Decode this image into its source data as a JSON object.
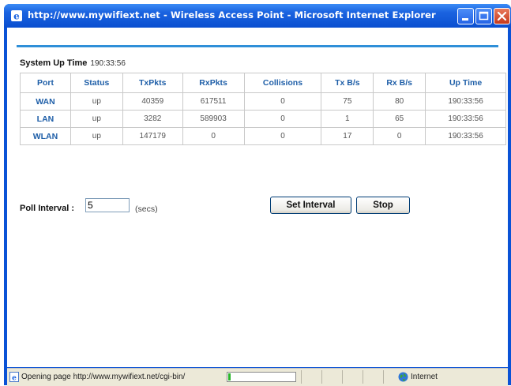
{
  "window": {
    "title": "http://www.mywifiext.net - Wireless Access Point - Microsoft Internet Explorer"
  },
  "uptime": {
    "label": "System Up Time",
    "value": "190:33:56"
  },
  "table": {
    "headers": [
      "Port",
      "Status",
      "TxPkts",
      "RxPkts",
      "Collisions",
      "Tx B/s",
      "Rx B/s",
      "Up Time"
    ],
    "rows": [
      [
        "WAN",
        "up",
        "40359",
        "617511",
        "0",
        "75",
        "80",
        "190:33:56"
      ],
      [
        "LAN",
        "up",
        "3282",
        "589903",
        "0",
        "1",
        "65",
        "190:33:56"
      ],
      [
        "WLAN",
        "up",
        "147179",
        "0",
        "0",
        "17",
        "0",
        "190:33:56"
      ]
    ]
  },
  "poll": {
    "label": "Poll Interval :",
    "value": "5",
    "unit": "(secs)"
  },
  "buttons": {
    "set_interval": "Set Interval",
    "stop": "Stop"
  },
  "statusbar": {
    "text": "Opening page http://www.mywifiext.net/cgi-bin/",
    "progress": 0.03,
    "zone": "Internet"
  },
  "icons": {
    "browser": "ie-icon",
    "minimize": "minimize-icon",
    "maximize": "maximize-icon",
    "close": "close-icon",
    "page": "page-icon",
    "zone": "globe-icon"
  }
}
